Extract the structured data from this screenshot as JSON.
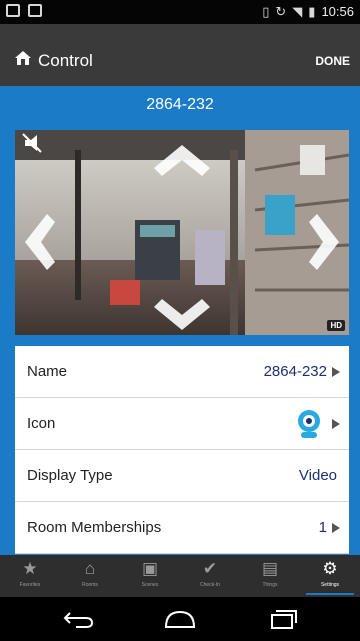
{
  "status_bar": {
    "time": "10:56"
  },
  "app_bar": {
    "title": "Control",
    "done_label": "DONE"
  },
  "camera": {
    "name": "2864-232",
    "quality_badge": "HD"
  },
  "settings_rows": [
    {
      "label": "Name",
      "value": "2864-232"
    },
    {
      "label": "Icon",
      "value": ""
    },
    {
      "label": "Display Type",
      "value": "Video"
    },
    {
      "label": "Room Memberships",
      "value": "1"
    }
  ],
  "tabs": [
    {
      "label": "Favorites",
      "icon": "star-icon"
    },
    {
      "label": "Rooms",
      "icon": "home-icon"
    },
    {
      "label": "Scenes",
      "icon": "scenes-icon"
    },
    {
      "label": "Check-In",
      "icon": "checkmark-icon"
    },
    {
      "label": "Things",
      "icon": "things-icon"
    },
    {
      "label": "Settings",
      "icon": "gear-icon",
      "active": true
    }
  ],
  "colors": {
    "accent": "#1c7bc6",
    "app_bar": "#3a3a3a",
    "value_text": "#1b2f72"
  }
}
